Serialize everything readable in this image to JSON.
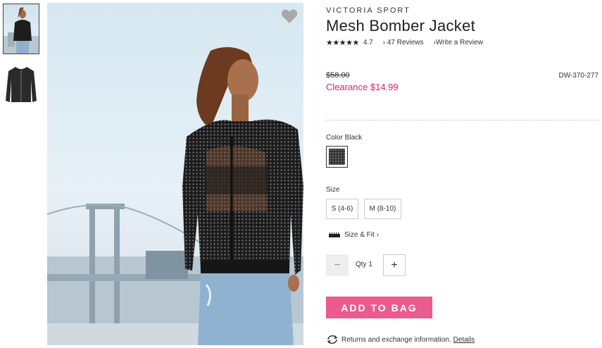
{
  "product": {
    "brand": "VICTORIA SPORT",
    "title": "Mesh Bomber Jacket",
    "stars": "★★★★★",
    "rating": "4.7",
    "reviews_link": "47 Reviews",
    "write_review_link": "Write a Review",
    "original_price": "$58.00",
    "sale_price": "Clearance $14.99",
    "sku": "DW-370-277"
  },
  "options": {
    "color_label": "Color Black",
    "size_label": "Size",
    "sizes": [
      "S (4-6)",
      "M (8-10)"
    ],
    "size_fit_link": "Size & Fit"
  },
  "quantity": {
    "minus": "−",
    "label": "Qty 1",
    "plus": "+"
  },
  "cart": {
    "add_button": "ADD TO BAG"
  },
  "returns": {
    "text": "Returns and exchange information.",
    "details_link": "Details"
  },
  "colors": {
    "accent_pink": "#eb5b8d",
    "price_pink": "#d7236f",
    "swatch": "#333333"
  },
  "icons": {
    "wishlist": "heart-icon",
    "size_fit": "ruler-icon",
    "returns": "refresh-icon"
  }
}
